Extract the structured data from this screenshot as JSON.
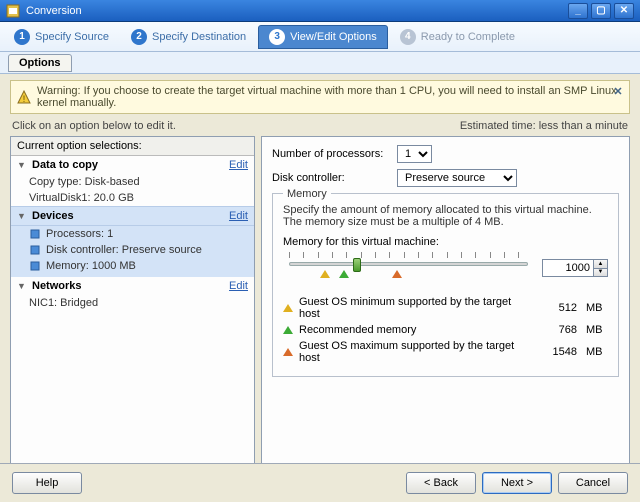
{
  "window": {
    "title": "Conversion"
  },
  "wizard_steps": {
    "s1": {
      "num": "1",
      "label": "Specify Source"
    },
    "s2": {
      "num": "2",
      "label": "Specify Destination"
    },
    "s3": {
      "num": "3",
      "label": "View/Edit Options"
    },
    "s4": {
      "num": "4",
      "label": "Ready to Complete"
    }
  },
  "subnav": {
    "options": "Options"
  },
  "warning": {
    "prefix": "Warning:",
    "text": "If you choose to create the target virtual machine with more than 1 CPU, you will need to install an SMP Linux kernel manually."
  },
  "infobar": {
    "left": "Click on an option below to edit it.",
    "right_label": "Estimated time:",
    "right_value": "less than a minute"
  },
  "left": {
    "header": "Current option selections:",
    "edit": "Edit",
    "data_to_copy": {
      "title": "Data to copy",
      "copy_type": "Copy type: Disk-based",
      "vdisk": "VirtualDisk1: 20.0 GB"
    },
    "devices": {
      "title": "Devices",
      "processors": "Processors: 1",
      "disk_controller": "Disk controller: Preserve source",
      "memory": "Memory: 1000 MB"
    },
    "networks": {
      "title": "Networks",
      "nic1": "NIC1: Bridged"
    }
  },
  "right": {
    "num_proc_label": "Number of processors:",
    "num_proc_value": "1",
    "disk_ctrl_label": "Disk controller:",
    "disk_ctrl_value": "Preserve source",
    "memory_legend": "Memory",
    "memory_desc": "Specify the amount of memory allocated to this virtual machine. The memory size must be a multiple of 4 MB.",
    "memory_slider_label": "Memory for this virtual machine:",
    "memory_value": "1000",
    "memory_unit": "MB",
    "mem_rows": {
      "min": {
        "label": "Guest OS minimum supported by the target host",
        "value": "512",
        "unit": "MB"
      },
      "rec": {
        "label": "Recommended memory",
        "value": "768",
        "unit": "MB"
      },
      "max": {
        "label": "Guest OS maximum supported by the target host",
        "value": "1548",
        "unit": "MB"
      }
    }
  },
  "footer": {
    "help": "Help",
    "back": "< Back",
    "next": "Next >",
    "cancel": "Cancel"
  }
}
